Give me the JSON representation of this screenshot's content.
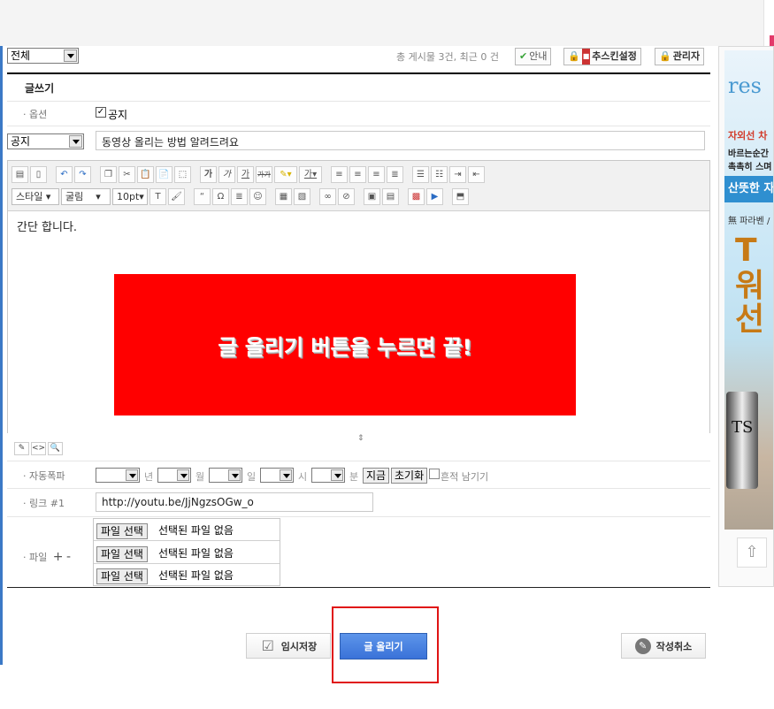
{
  "header": {
    "category_select": "전체",
    "stats": "총 게시물 3건, 최근 0 건",
    "guide_label": "안내",
    "skin_label": "추스킨설정",
    "admin_label": "관리자"
  },
  "form": {
    "title": "글쓰기",
    "option_label": "옵션",
    "notice_checkbox_label": "공지",
    "category_value": "공지",
    "subject_value": "동영상 올리는 방법 알려드려요",
    "autopost_label": "자동폭파",
    "units": {
      "year": "년",
      "month": "월",
      "day": "일",
      "hour": "시",
      "minute": "분"
    },
    "now_button": "지금",
    "reset_button": "초기화",
    "trace_label": "흔적 남기기",
    "link_label": "링크 #1",
    "link_value": "http://youtu.be/JjNgzsOGw_o",
    "file_label": "파일",
    "file_add": "+",
    "file_remove": "-",
    "files": [
      {
        "button": "파일 선택",
        "status": "선택된 파일 없음"
      },
      {
        "button": "파일 선택",
        "status": "선택된 파일 없음"
      },
      {
        "button": "파일 선택",
        "status": "선택된 파일 없음"
      }
    ]
  },
  "editor": {
    "style_dd": "스타일",
    "font_dd": "굴림",
    "size_dd": "10pt",
    "body_text": "간단 합니다.",
    "banner_text": "글 올리기 버튼을 누르면 끝!"
  },
  "actions": {
    "temp_save": "임시저장",
    "submit": "글 올리기",
    "cancel": "작성취소"
  },
  "ad": {
    "logo": "res",
    "line1": "자외선 차",
    "line2": "바르는순간",
    "line3": "촉촉히 스며",
    "band": "산뜻한 자",
    "line4": "無 파라벤 /",
    "big1": "T",
    "big2": "워",
    "big3": "선",
    "can_mark": "TS"
  },
  "colors": {
    "accent_blue": "#3a72d8",
    "banner_red": "#ff0000",
    "highlight_red": "#e01414"
  }
}
